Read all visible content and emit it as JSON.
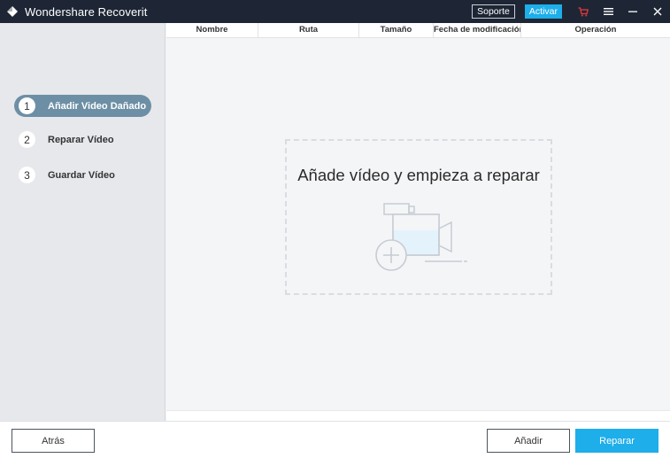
{
  "window": {
    "title": "Wondershare Recoverit",
    "support_label": "Soporte",
    "activate_label": "Activar",
    "icons": [
      "app-logo-icon",
      "cart-icon",
      "menu-icon",
      "minimize-icon",
      "close-icon"
    ]
  },
  "sidebar": {
    "steps": [
      {
        "number": "1",
        "label": "Añadir Video Dañado",
        "active": true
      },
      {
        "number": "2",
        "label": "Reparar Vídeo",
        "active": false
      },
      {
        "number": "3",
        "label": "Guardar Vídeo",
        "active": false
      }
    ]
  },
  "table": {
    "columns": [
      "Nombre",
      "Ruta",
      "Tamaño",
      "Fecha de modificación",
      "Operación"
    ]
  },
  "dropzone": {
    "text": "Añade vídeo y empieza a reparar",
    "icon": "add-video-camera-icon"
  },
  "footer": {
    "back_label": "Atrás",
    "add_label": "Añadir",
    "repair_label": "Reparar"
  },
  "colors": {
    "titlebar": "#1e2635",
    "accent": "#1eaeea",
    "active_step": "#6d8fa5",
    "cart": "#e8383d"
  }
}
